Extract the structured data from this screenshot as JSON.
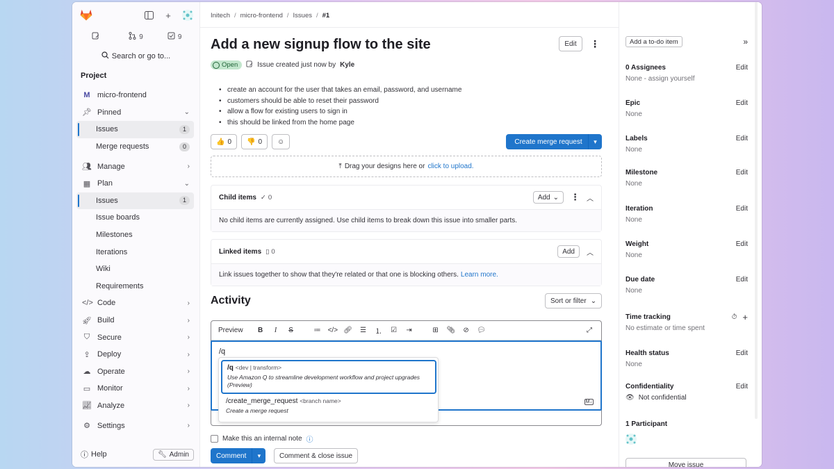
{
  "sidebar": {
    "counts": [
      {
        "icon": "issue-icon",
        "value": ""
      },
      {
        "icon": "merge-request-icon",
        "value": "9"
      },
      {
        "icon": "todo-icon",
        "value": "9"
      }
    ],
    "search_label": "Search or go to...",
    "section_title": "Project",
    "project_letter": "M",
    "project_name": "micro-frontend",
    "items": [
      {
        "label": "Pinned",
        "icon": "pin-icon"
      },
      {
        "label": "Issues",
        "badge": "1"
      },
      {
        "label": "Merge requests",
        "badge": "0"
      },
      {
        "label": "Manage",
        "icon": "users-icon"
      },
      {
        "label": "Plan",
        "icon": "calendar-icon"
      },
      {
        "label": "Issues",
        "badge": "1"
      },
      {
        "label": "Issue boards"
      },
      {
        "label": "Milestones"
      },
      {
        "label": "Iterations"
      },
      {
        "label": "Wiki"
      },
      {
        "label": "Requirements"
      },
      {
        "label": "Code",
        "icon": "code-icon"
      },
      {
        "label": "Build",
        "icon": "rocket-icon"
      },
      {
        "label": "Secure",
        "icon": "shield-icon"
      },
      {
        "label": "Deploy",
        "icon": "deploy-icon"
      },
      {
        "label": "Operate",
        "icon": "cloud-icon"
      },
      {
        "label": "Monitor",
        "icon": "monitor-icon"
      },
      {
        "label": "Analyze",
        "icon": "chart-icon"
      },
      {
        "label": "Settings",
        "icon": "gear-icon"
      }
    ],
    "help_label": "Help",
    "admin_label": "Admin"
  },
  "breadcrumb": [
    "Initech",
    "micro-frontend",
    "Issues",
    "#1"
  ],
  "issue": {
    "title": "Add a new signup flow to the site",
    "edit_label": "Edit",
    "status": "Open",
    "meta_prefix": "Issue created just now by",
    "author": "Kyle",
    "description": [
      "create an account for the user that takes an email, password, and username",
      "customers should be able to reset their password",
      "allow a flow for existing users to sign in",
      "this should be linked from the home page"
    ],
    "thumbs_up": "0",
    "thumbs_down": "0",
    "create_mr_label": "Create merge request",
    "dropzone_text": "Drag your designs here or",
    "dropzone_link": "click to upload."
  },
  "child_items": {
    "title": "Child items",
    "count": "0",
    "add_label": "Add",
    "empty_text": "No child items are currently assigned. Use child items to break down this issue into smaller parts."
  },
  "linked_items": {
    "title": "Linked items",
    "count": "0",
    "add_label": "Add",
    "empty_text": "Link issues together to show that they're related or that one is blocking others.",
    "learn_more": "Learn more."
  },
  "activity": {
    "title": "Activity",
    "sort_label": "Sort or filter",
    "preview_label": "Preview",
    "input_value": "/q",
    "autocomplete": [
      {
        "command": "/q",
        "args": "<dev | transform>",
        "description": "Use Amazon Q to streamline development workflow and project upgrades (Preview)"
      },
      {
        "command": "/create_merge_request",
        "args": "<branch name>",
        "description": "Create a merge request"
      }
    ],
    "internal_note_label": "Make this an internal note",
    "comment_label": "Comment",
    "comment_close_label": "Comment & close issue"
  },
  "right_sidebar": {
    "todo_label": "Add a to-do item",
    "attributes": [
      {
        "title": "0 Assignees",
        "value": "None - assign yourself",
        "action": "Edit"
      },
      {
        "title": "Epic",
        "value": "None",
        "action": "Edit"
      },
      {
        "title": "Labels",
        "value": "None",
        "action": "Edit"
      },
      {
        "title": "Milestone",
        "value": "None",
        "action": "Edit"
      },
      {
        "title": "Iteration",
        "value": "None",
        "action": "Edit"
      },
      {
        "title": "Weight",
        "value": "None",
        "action": "Edit"
      },
      {
        "title": "Due date",
        "value": "None",
        "action": "Edit"
      },
      {
        "title": "Time tracking",
        "value": "No estimate or time spent",
        "action": ""
      },
      {
        "title": "Health status",
        "value": "None",
        "action": "Edit"
      },
      {
        "title": "Confidentiality",
        "value": "Not confidential",
        "action": "Edit"
      }
    ],
    "participants_title": "1 Participant",
    "move_label": "Move issue"
  },
  "colors": {
    "accent": "#1f75cb",
    "open_badge_bg": "#c3e6cd",
    "open_badge_fg": "#24663b",
    "brand": "#e24329"
  }
}
